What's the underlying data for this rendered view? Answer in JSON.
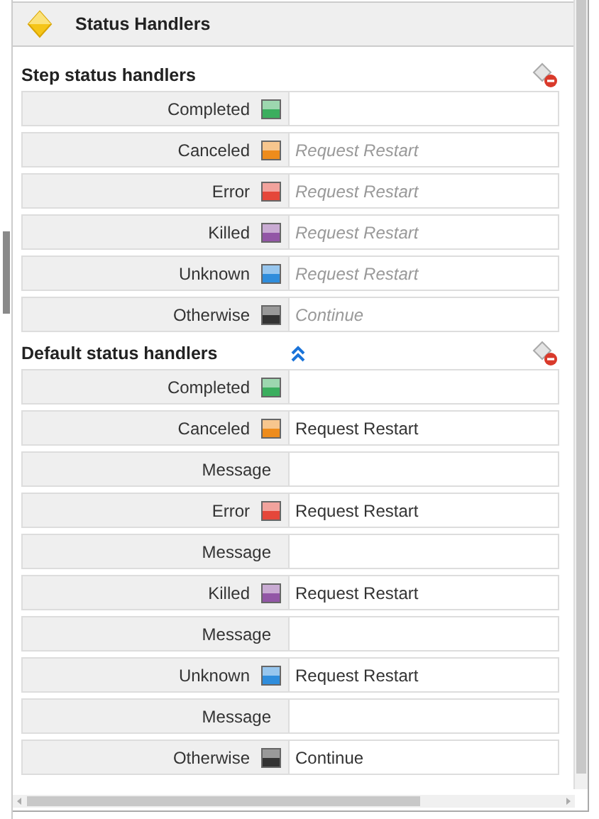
{
  "panel": {
    "title": "Status Handlers"
  },
  "sections": [
    {
      "title": "Step status handlers",
      "rows": [
        {
          "kind": "status",
          "label": "Completed",
          "color": "#3bae5e"
        },
        {
          "kind": "status",
          "label": "Canceled",
          "color": "#ee8c1c",
          "placeholder": "Request Restart"
        },
        {
          "kind": "status",
          "label": "Error",
          "color": "#e5473a",
          "placeholder": "Request Restart"
        },
        {
          "kind": "status",
          "label": "Killed",
          "color": "#9256a6",
          "placeholder": "Request Restart"
        },
        {
          "kind": "status",
          "label": "Unknown",
          "color": "#2f8ddc",
          "placeholder": "Request Restart"
        },
        {
          "kind": "status",
          "label": "Otherwise",
          "color": "#333333",
          "placeholder": "Continue"
        }
      ]
    },
    {
      "title": "Default status handlers",
      "collapse_toggle": true,
      "rows": [
        {
          "kind": "status",
          "label": "Completed",
          "color": "#3bae5e"
        },
        {
          "kind": "status",
          "label": "Canceled",
          "color": "#ee8c1c",
          "value": "Request Restart"
        },
        {
          "kind": "message",
          "label": "Message"
        },
        {
          "kind": "status",
          "label": "Error",
          "color": "#e5473a",
          "value": "Request Restart"
        },
        {
          "kind": "message",
          "label": "Message"
        },
        {
          "kind": "status",
          "label": "Killed",
          "color": "#9256a6",
          "value": "Request Restart"
        },
        {
          "kind": "message",
          "label": "Message"
        },
        {
          "kind": "status",
          "label": "Unknown",
          "color": "#2f8ddc",
          "value": "Request Restart"
        },
        {
          "kind": "message",
          "label": "Message"
        },
        {
          "kind": "status",
          "label": "Otherwise",
          "color": "#333333",
          "value": "Continue"
        }
      ]
    }
  ]
}
